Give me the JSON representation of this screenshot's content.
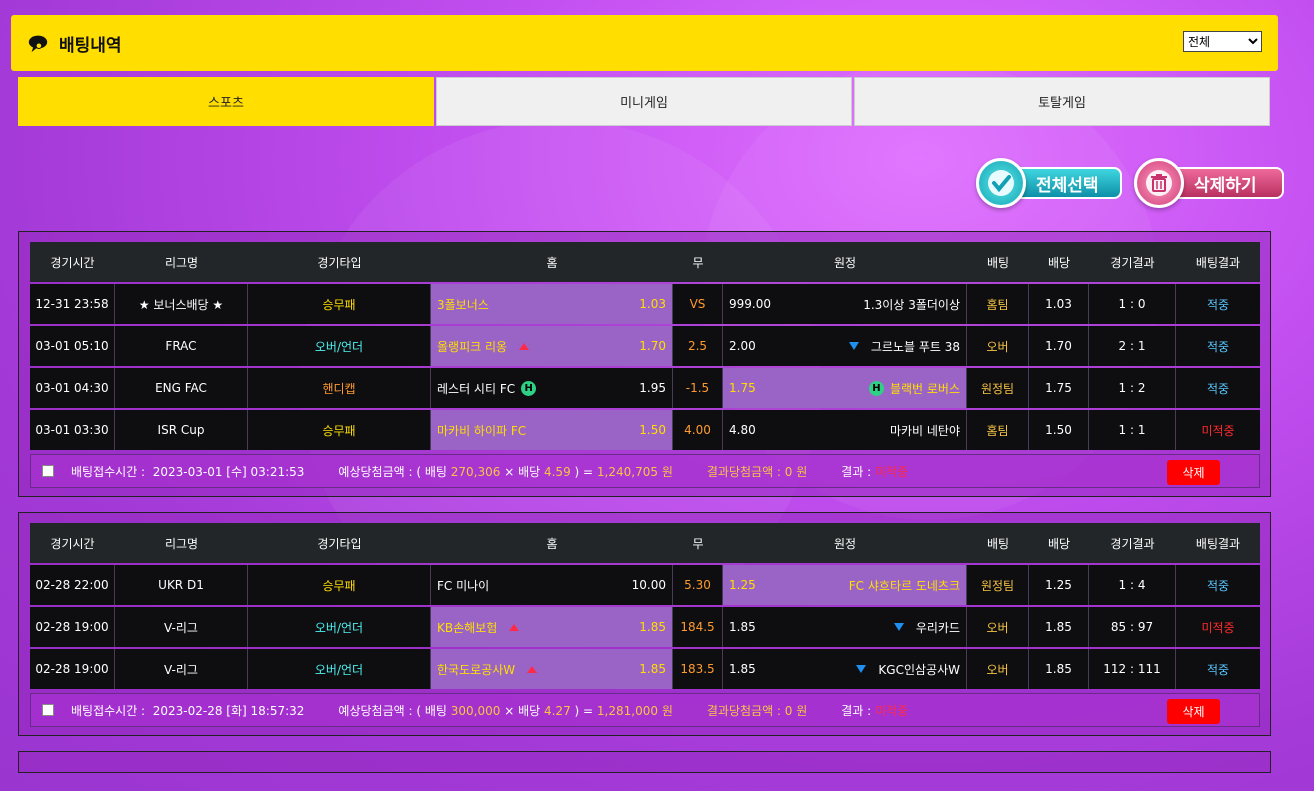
{
  "header": {
    "title": "배팅내역",
    "filter_selected": "전체"
  },
  "tabs": [
    {
      "label": "스포츠",
      "active": true
    },
    {
      "label": "미니게임",
      "active": false
    },
    {
      "label": "토탈게임",
      "active": false
    }
  ],
  "actions": {
    "select_all": "전체선택",
    "delete": "삭제하기"
  },
  "columns": [
    "경기시간",
    "리그명",
    "경기타입",
    "홈",
    "무",
    "원정",
    "배팅",
    "배당",
    "경기결과",
    "배팅결과"
  ],
  "bets": [
    {
      "rows": [
        {
          "time": "12-31 23:58",
          "league": "★ 보너스배당 ★",
          "type": "승무패",
          "type_color": "yellow",
          "home": "3폴보너스",
          "home_odds": "1.03",
          "home_mark": "",
          "home_sel": true,
          "draw": "VS",
          "draw_color": "orange",
          "away": "1.3이상 3폴더이상",
          "away_odds": "999.00",
          "away_mark": "",
          "away_sel": false,
          "bet": "홈팀",
          "odds": "1.03",
          "score": "1 : 0",
          "result": "적중",
          "result_color": "blue"
        },
        {
          "time": "03-01 05:10",
          "league": "FRAC",
          "type": "오버/언더",
          "type_color": "cyan",
          "home": "올랭피크 리옹",
          "home_odds": "1.70",
          "home_mark": "up",
          "home_sel": true,
          "draw": "2.5",
          "draw_color": "orange",
          "away": "그르노블 푸트 38",
          "away_odds": "2.00",
          "away_mark": "down",
          "away_sel": false,
          "bet": "오버",
          "odds": "1.70",
          "score": "2 : 1",
          "result": "적중",
          "result_color": "blue"
        },
        {
          "time": "03-01 04:30",
          "league": "ENG FAC",
          "type": "핸디캡",
          "type_color": "orange",
          "home": "레스터 시티 FC",
          "home_odds": "1.95",
          "home_mark": "H",
          "home_sel": false,
          "draw": "-1.5",
          "draw_color": "orange",
          "away": "블랙번 로버스",
          "away_odds": "1.75",
          "away_mark": "H",
          "away_sel": true,
          "bet": "원정팀",
          "odds": "1.75",
          "score": "1 : 2",
          "result": "적중",
          "result_color": "blue"
        },
        {
          "time": "03-01 03:30",
          "league": "ISR Cup",
          "type": "승무패",
          "type_color": "yellow",
          "home": "마카비 하이파 FC",
          "home_odds": "1.50",
          "home_mark": "",
          "home_sel": true,
          "draw": "4.00",
          "draw_color": "orange",
          "away": "마카비 네탄야",
          "away_odds": "4.80",
          "away_mark": "",
          "away_sel": false,
          "bet": "홈팀",
          "odds": "1.50",
          "score": "1 : 1",
          "result": "미적중",
          "result_color": "red"
        }
      ],
      "footer": {
        "time_label": "배팅접수시간 :",
        "time": "2023-03-01 [수] 03:21:53",
        "expect_label": "예상당첨금액 : ( 배팅",
        "bet_amount": "270,306",
        "times": "× 배당",
        "total_odds": "4.59",
        "eq": ") =",
        "payout": "1,240,705",
        "won": "원",
        "result_amount_label": "결과당첨금액 : 0 원",
        "result_label": "결과 :",
        "result": "미적중",
        "delete": "삭제"
      }
    },
    {
      "rows": [
        {
          "time": "02-28 22:00",
          "league": "UKR D1",
          "type": "승무패",
          "type_color": "yellow",
          "home": "FC 미나이",
          "home_odds": "10.00",
          "home_mark": "",
          "home_sel": false,
          "draw": "5.30",
          "draw_color": "orange",
          "away": "FC 샤흐타르 도네츠크",
          "away_odds": "1.25",
          "away_mark": "",
          "away_sel": true,
          "bet": "원정팀",
          "odds": "1.25",
          "score": "1 : 4",
          "result": "적중",
          "result_color": "blue"
        },
        {
          "time": "02-28 19:00",
          "league": "V-리그",
          "type": "오버/언더",
          "type_color": "cyan",
          "home": "KB손해보험",
          "home_odds": "1.85",
          "home_mark": "up",
          "home_sel": true,
          "draw": "184.5",
          "draw_color": "orange",
          "away": "우리카드",
          "away_odds": "1.85",
          "away_mark": "down",
          "away_sel": false,
          "bet": "오버",
          "odds": "1.85",
          "score": "85 : 97",
          "result": "미적중",
          "result_color": "red"
        },
        {
          "time": "02-28 19:00",
          "league": "V-리그",
          "type": "오버/언더",
          "type_color": "cyan",
          "home": "한국도로공사W",
          "home_odds": "1.85",
          "home_mark": "up",
          "home_sel": true,
          "draw": "183.5",
          "draw_color": "orange",
          "away": "KGC인삼공사W",
          "away_odds": "1.85",
          "away_mark": "down",
          "away_sel": false,
          "bet": "오버",
          "odds": "1.85",
          "score": "112 : 111",
          "result": "적중",
          "result_color": "blue"
        }
      ],
      "footer": {
        "time_label": "배팅접수시간 :",
        "time": "2023-02-28 [화] 18:57:32",
        "expect_label": "예상당첨금액 : ( 배팅",
        "bet_amount": "300,000",
        "times": "× 배당",
        "total_odds": "4.27",
        "eq": ") =",
        "payout": "1,281,000",
        "won": "원",
        "result_amount_label": "결과당첨금액 : 0 원",
        "result_label": "결과 :",
        "result": "미적중",
        "delete": "삭제"
      }
    }
  ]
}
